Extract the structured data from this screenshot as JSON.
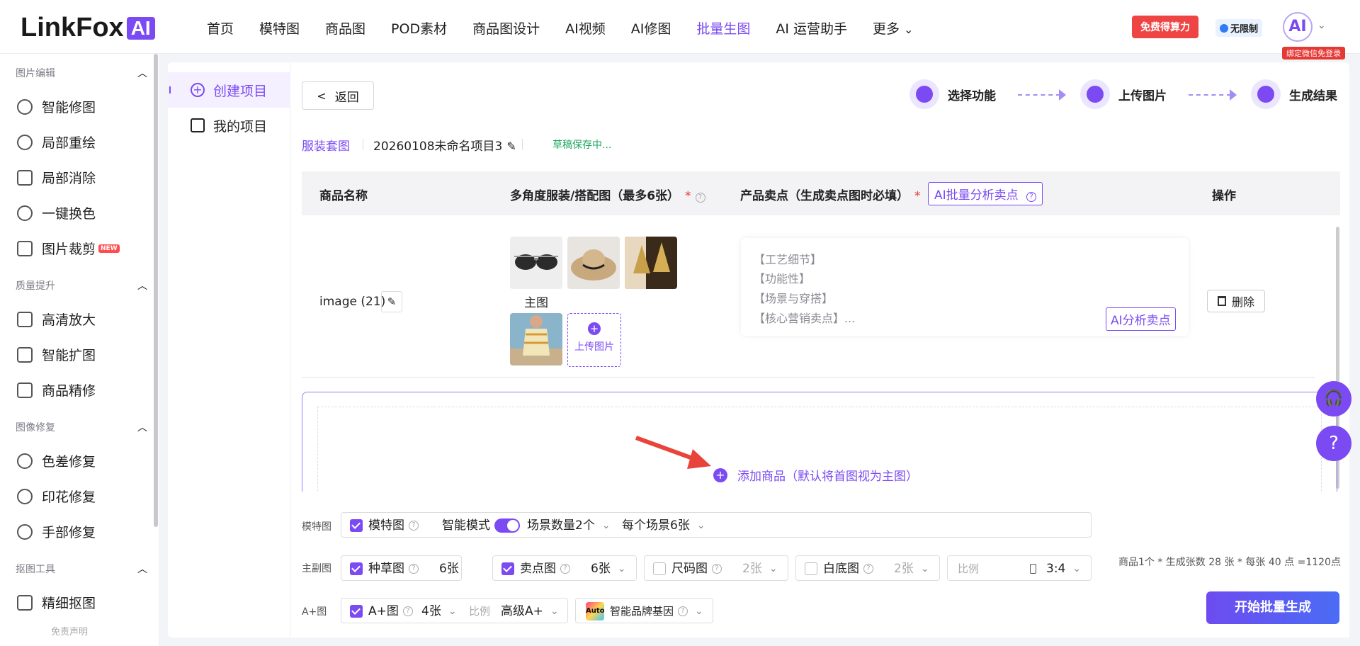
{
  "brand": {
    "name": "LinkFox",
    "badge": "AI"
  },
  "nav": [
    "首页",
    "模特图",
    "商品图",
    "POD素材",
    "商品图设计",
    "AI视频",
    "AI修图",
    "批量生图",
    "AI 运营助手",
    "更多"
  ],
  "header": {
    "free_btn": "免费得算力",
    "unlimited": "无限制",
    "avatar": "AI",
    "bind_tip": "绑定微信免登录"
  },
  "sidebar": {
    "groups": [
      "图片编辑",
      "质量提升",
      "图像修复",
      "抠图工具"
    ],
    "items": [
      "智能修图",
      "局部重绘",
      "局部消除",
      "一键换色",
      "图片裁剪",
      "高清放大",
      "智能扩图",
      "商品精修",
      "色差修复",
      "印花修复",
      "手部修复",
      "精细抠图"
    ],
    "new_badge": "NEW",
    "disclaimer": "免责声明"
  },
  "subnav": {
    "create": "创建项目",
    "mine": "我的项目"
  },
  "back": "返回",
  "steps": [
    "选择功能",
    "上传图片",
    "生成结果"
  ],
  "project": {
    "category": "服装套图",
    "name": "20260108未命名项目3",
    "status": "草稿保存中..."
  },
  "table": {
    "headers": [
      "商品名称",
      "多角度服装/搭配图（最多6张）",
      "产品卖点（生成卖点图时必填）",
      "操作"
    ],
    "required": "*",
    "ai_batch": "AI批量分析卖点",
    "row": {
      "name": "image (21)",
      "main_label": "主图",
      "upload": "上传图片",
      "sell_points": [
        "【工艺细节】",
        "【功能性】",
        "【场景与穿搭】",
        "【核心营销卖点】..."
      ],
      "ai_analyze": "AI分析卖点",
      "delete": "删除"
    }
  },
  "add_product": "添加商品（默认将首图视为主图）",
  "bottom": {
    "labels": [
      "模特图",
      "主副图",
      "A+图"
    ],
    "model": {
      "check": "模特图",
      "smart": "智能模式",
      "scenes": "场景数量2个",
      "per_scene": "每个场景6张"
    },
    "main": {
      "grass": "种草图",
      "grass_n": "6张",
      "sell": "卖点图",
      "sell_n": "6张",
      "size": "尺码图",
      "size_n": "2张",
      "white": "白底图",
      "white_n": "2张",
      "ratio_label": "比例",
      "ratio": "3:4"
    },
    "aplus": {
      "check": "A+图",
      "count": "4张",
      "ratio_label": "比例",
      "level": "高级A+",
      "brand": "智能品牌基因",
      "auto": "Auto"
    },
    "summary": "商品1个 * 生成张数 28 张 * 每张 40 点 =1120点",
    "start": "开始批量生成"
  },
  "colors": {
    "accent": "#7b4af2",
    "danger": "#e53935",
    "save": "#19a55c"
  }
}
